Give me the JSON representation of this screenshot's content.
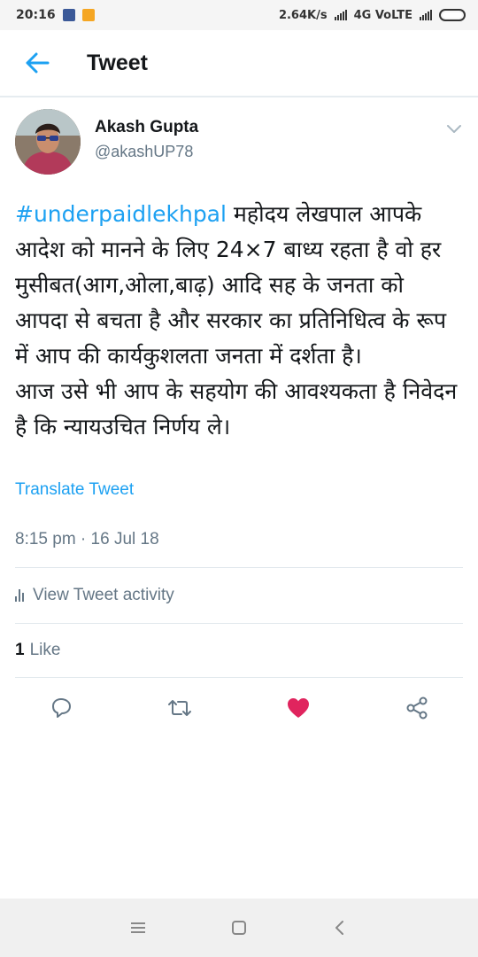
{
  "status_bar": {
    "time": "20:16",
    "net_speed": "2.64K/s",
    "network": "4G VoLTE"
  },
  "header": {
    "title": "Tweet"
  },
  "tweet": {
    "author_name": "Akash Gupta",
    "author_handle": "@akashUP78",
    "hashtag": "#underpaidlekhpal",
    "body": " महोदय लेखपाल आपके आदेश को मानने के लिए 24×7 बाध्य रहता है वो हर मुसीबत(आग,ओला,बाढ़) आदि सह के जनता को आपदा से बचता है और सरकार का प्रतिनिधित्व के रूप में आप की कार्यकुशलता जनता में दर्शता है।\nआज उसे भी आप के सहयोग की आवश्यकता है निवेदन है कि न्यायउचित निर्णय ले।",
    "translate_label": "Translate Tweet",
    "timestamp": "8:15 pm · 16 Jul 18",
    "activity_label": "View Tweet activity",
    "like_count": "1",
    "like_label": "Like"
  },
  "colors": {
    "accent": "#1da1f2",
    "like": "#e0245e",
    "secondary_text": "#657786"
  },
  "icons": {
    "back": "arrow-left-icon",
    "caret": "chevron-down-icon",
    "reply": "reply-icon",
    "retweet": "retweet-icon",
    "like": "heart-icon",
    "share": "share-icon"
  }
}
